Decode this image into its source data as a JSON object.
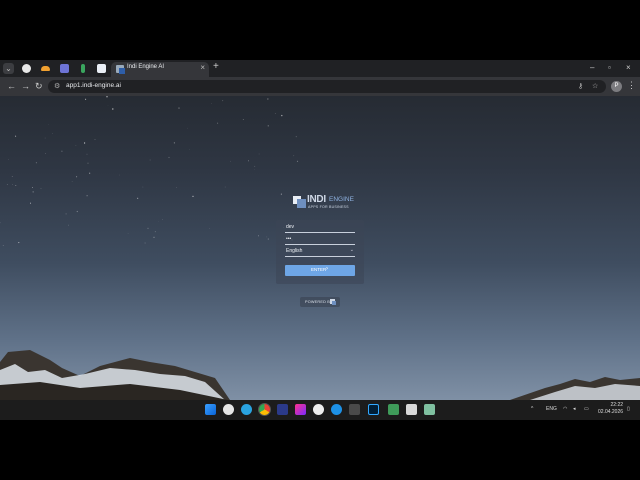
{
  "browser": {
    "active_tab_title": "Indi Engine AI",
    "new_tab_glyph": "+",
    "tab_close_glyph": "×",
    "url": "app1.indi-engine.ai",
    "profile_initial": "P",
    "icons": [
      "tab-search-icon",
      "github-icon",
      "cloud-icon",
      "grid-icon",
      "leaf-icon",
      "indi-favicon-icon",
      "back-icon",
      "forward-icon",
      "reload-icon",
      "site-settings-icon",
      "password-key-icon",
      "star-icon",
      "kebab-menu-icon"
    ]
  },
  "login": {
    "logo_main": "INDI",
    "logo_sub": "ENGINE",
    "logo_tagline": "APPS FOR BUSINESS",
    "username_value": "dev",
    "password_value": "•••",
    "language_value": "English",
    "enter_label": "ENTER",
    "powered_by": "POWERED BY"
  },
  "taskbar": {
    "language": "ENG",
    "time": "22:22",
    "date": "02.04.2026",
    "icons": [
      "windows-start-icon",
      "app-icon",
      "telegram-icon",
      "chrome-icon",
      "monitor-icon",
      "jetbrains-icon",
      "github-desktop-icon",
      "docker-icon",
      "terminal-icon",
      "photoshop-icon",
      "app-icon-2",
      "app-icon-3",
      "app-icon-4"
    ]
  },
  "colors": {
    "accent_button": "#6ea6e6",
    "logo_blue": "#6e8fbf"
  }
}
